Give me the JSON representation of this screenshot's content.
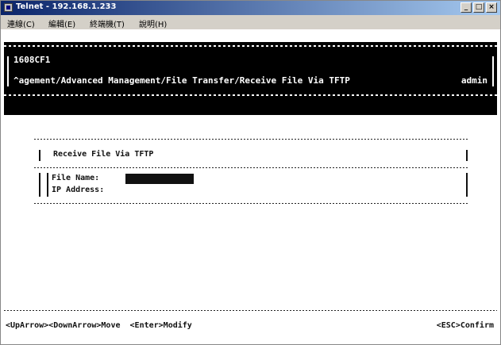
{
  "window": {
    "title": "Telnet - 192.168.1.233",
    "minimize": "_",
    "maximize": "□",
    "close": "×"
  },
  "menu": [
    "連線(C)",
    "編輯(E)",
    "終端機(T)",
    "說明(H)"
  ],
  "header": {
    "device": "1608CF1",
    "path": "^agement/Advanced Management/File Transfer/Receive File Via TFTP",
    "user": "admin"
  },
  "dialog": {
    "title": "Receive File Via TFTP",
    "fields": [
      {
        "label": "File Name:",
        "value": ""
      },
      {
        "label": "IP Address:",
        "value": ""
      }
    ]
  },
  "footer": {
    "left": "<UpArrow><DownArrow>Move  <Enter>Modify",
    "right": "<ESC>Confirm"
  },
  "colors": {
    "titlebar_start": "#0a246a",
    "titlebar_end": "#a6caf0",
    "header_bg": "#000000",
    "header_fg": "#ffffff"
  }
}
